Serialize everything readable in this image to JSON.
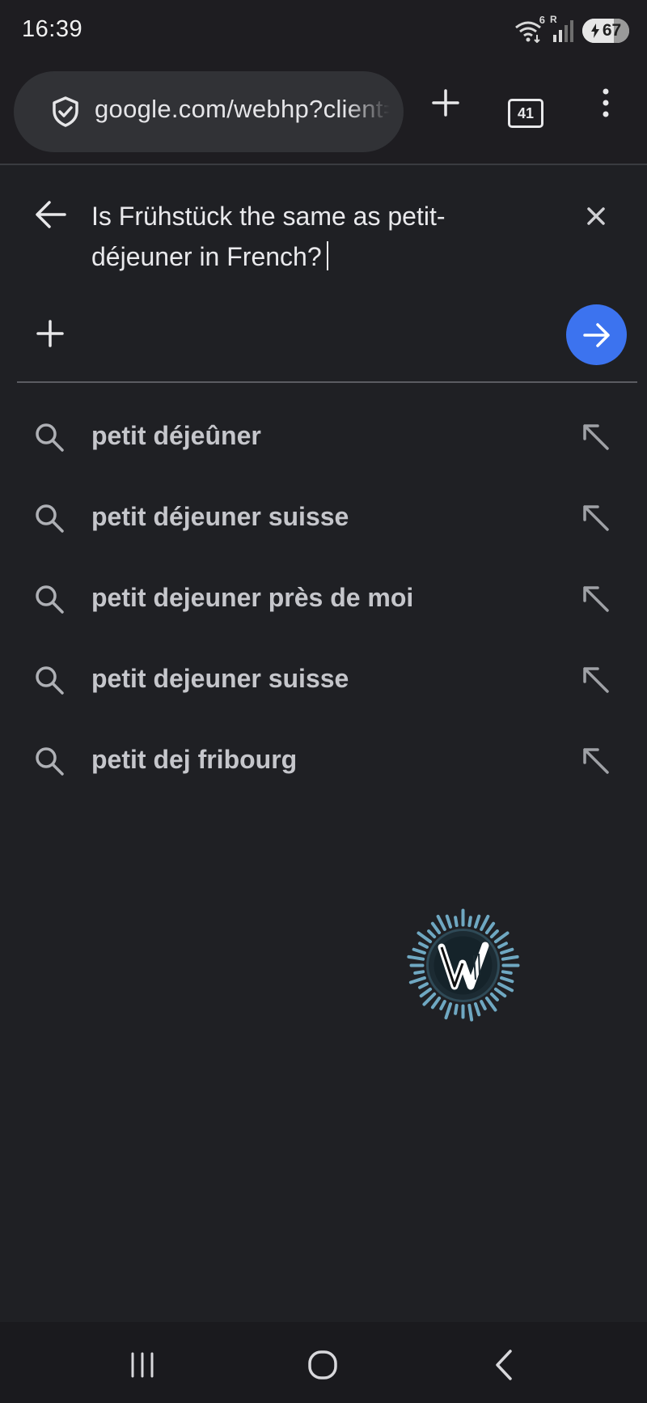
{
  "status_bar": {
    "time": "16:39",
    "wifi_label": "6",
    "signal_label": "R",
    "battery_level": "67"
  },
  "browser_toolbar": {
    "url": "google.com/webhp?client=ms-android-samsung",
    "tab_count": "41"
  },
  "search": {
    "query": "Is Frühstück the same as petit-déjeuner in French?",
    "suggestions": [
      {
        "text": "petit déjeûner"
      },
      {
        "text": "petit déjeuner suisse"
      },
      {
        "text": "petit dejeuner près de moi"
      },
      {
        "text": "petit dejeuner suisse"
      },
      {
        "text": "petit dej fribourg"
      }
    ]
  },
  "icons": {
    "shield": "shield-check-icon",
    "new_tab": "plus-icon",
    "menu": "more-vertical-icon",
    "back": "arrow-left-icon",
    "clear": "close-icon",
    "add": "plus-icon",
    "go": "arrow-right-icon",
    "suggestion": "search-icon",
    "fill_query": "arrow-up-left-icon"
  },
  "colors": {
    "background": "#1f2024",
    "toolbar": "#1e1d21",
    "urlbar": "#313236",
    "accent_blue": "#3c73ef",
    "suggestion_text": "#c5c6cb"
  }
}
